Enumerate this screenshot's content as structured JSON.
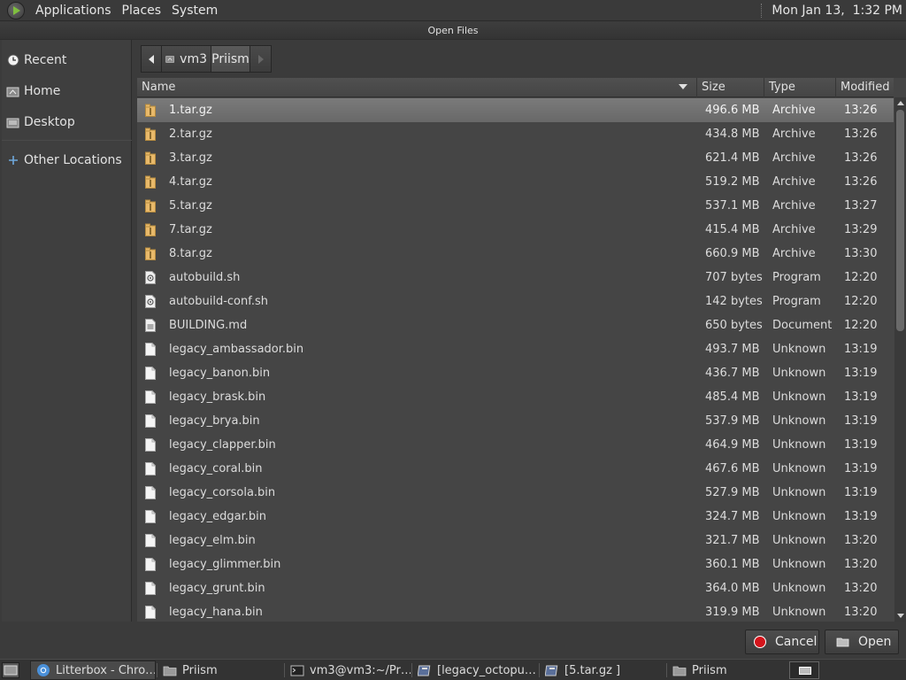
{
  "top_panel": {
    "menus": [
      "Applications",
      "Places",
      "System"
    ],
    "clock": "Mon Jan 13,  1:32 PM"
  },
  "dialog": {
    "title": "Open Files"
  },
  "sidebar": {
    "items": [
      {
        "label": "Recent",
        "icon": "clock-icon"
      },
      {
        "label": "Home",
        "icon": "home-icon"
      },
      {
        "label": "Desktop",
        "icon": "desktop-icon"
      },
      {
        "label": "Other Locations",
        "icon": "plus-icon"
      }
    ]
  },
  "pathbar": {
    "segments": [
      "vm3",
      "Priism"
    ]
  },
  "columns": {
    "name": "Name",
    "size": "Size",
    "type": "Type",
    "modified": "Modified"
  },
  "files": [
    {
      "name": "1.tar.gz",
      "size": "496.6 MB",
      "type": "Archive",
      "modified": "13:26",
      "icon": "archive-icon",
      "selected": true
    },
    {
      "name": "2.tar.gz",
      "size": "434.8 MB",
      "type": "Archive",
      "modified": "13:26",
      "icon": "archive-icon"
    },
    {
      "name": "3.tar.gz",
      "size": "621.4 MB",
      "type": "Archive",
      "modified": "13:26",
      "icon": "archive-icon"
    },
    {
      "name": "4.tar.gz",
      "size": "519.2 MB",
      "type": "Archive",
      "modified": "13:26",
      "icon": "archive-icon"
    },
    {
      "name": "5.tar.gz",
      "size": "537.1 MB",
      "type": "Archive",
      "modified": "13:27",
      "icon": "archive-icon"
    },
    {
      "name": "7.tar.gz",
      "size": "415.4 MB",
      "type": "Archive",
      "modified": "13:29",
      "icon": "archive-icon"
    },
    {
      "name": "8.tar.gz",
      "size": "660.9 MB",
      "type": "Archive",
      "modified": "13:30",
      "icon": "archive-icon"
    },
    {
      "name": "autobuild.sh",
      "size": "707 bytes",
      "type": "Program",
      "modified": "12:20",
      "icon": "script-icon"
    },
    {
      "name": "autobuild-conf.sh",
      "size": "142 bytes",
      "type": "Program",
      "modified": "12:20",
      "icon": "script-icon"
    },
    {
      "name": "BUILDING.md",
      "size": "650 bytes",
      "type": "Document",
      "modified": "12:20",
      "icon": "document-icon"
    },
    {
      "name": "legacy_ambassador.bin",
      "size": "493.7 MB",
      "type": "Unknown",
      "modified": "13:19",
      "icon": "file-icon"
    },
    {
      "name": "legacy_banon.bin",
      "size": "436.7 MB",
      "type": "Unknown",
      "modified": "13:19",
      "icon": "file-icon"
    },
    {
      "name": "legacy_brask.bin",
      "size": "485.4 MB",
      "type": "Unknown",
      "modified": "13:19",
      "icon": "file-icon"
    },
    {
      "name": "legacy_brya.bin",
      "size": "537.9 MB",
      "type": "Unknown",
      "modified": "13:19",
      "icon": "file-icon"
    },
    {
      "name": "legacy_clapper.bin",
      "size": "464.9 MB",
      "type": "Unknown",
      "modified": "13:19",
      "icon": "file-icon"
    },
    {
      "name": "legacy_coral.bin",
      "size": "467.6 MB",
      "type": "Unknown",
      "modified": "13:19",
      "icon": "file-icon"
    },
    {
      "name": "legacy_corsola.bin",
      "size": "527.9 MB",
      "type": "Unknown",
      "modified": "13:19",
      "icon": "file-icon"
    },
    {
      "name": "legacy_edgar.bin",
      "size": "324.7 MB",
      "type": "Unknown",
      "modified": "13:19",
      "icon": "file-icon"
    },
    {
      "name": "legacy_elm.bin",
      "size": "321.7 MB",
      "type": "Unknown",
      "modified": "13:20",
      "icon": "file-icon"
    },
    {
      "name": "legacy_glimmer.bin",
      "size": "360.1 MB",
      "type": "Unknown",
      "modified": "13:20",
      "icon": "file-icon"
    },
    {
      "name": "legacy_grunt.bin",
      "size": "364.0 MB",
      "type": "Unknown",
      "modified": "13:20",
      "icon": "file-icon"
    },
    {
      "name": "legacy_hana.bin",
      "size": "319.9 MB",
      "type": "Unknown",
      "modified": "13:20",
      "icon": "file-icon"
    }
  ],
  "buttons": {
    "cancel": "Cancel",
    "open": "Open"
  },
  "taskbar": {
    "items": [
      {
        "label": "Litterbox - Chro…",
        "icon": "chrome-icon",
        "active": true
      },
      {
        "label": "Priism",
        "icon": "folder-icon"
      },
      {
        "label": "vm3@vm3:~/Pr…",
        "icon": "terminal-icon"
      },
      {
        "label": "[legacy_octopu…",
        "icon": "archive-manager-icon"
      },
      {
        "label": "[5.tar.gz ]",
        "icon": "archive-manager-icon"
      },
      {
        "label": "Priism",
        "icon": "folder-icon"
      }
    ]
  },
  "colors": {
    "selection": "#707070",
    "cancel_icon": "#d4141b",
    "archive_icon": "#e8b96a"
  }
}
